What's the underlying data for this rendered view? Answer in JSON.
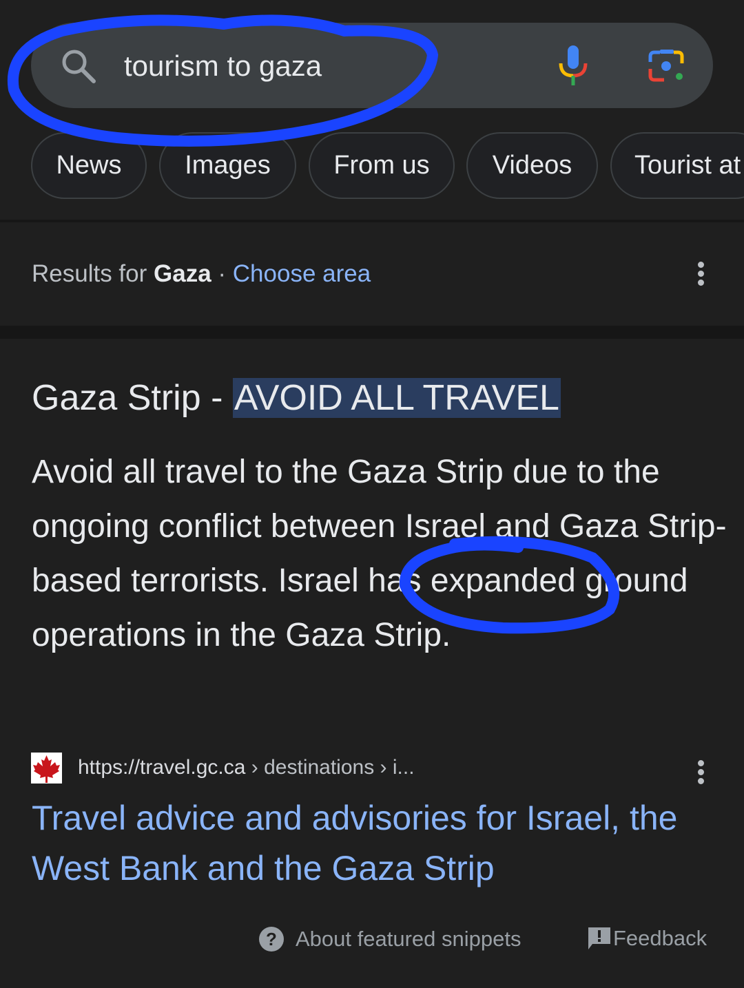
{
  "search": {
    "query": "tourism to gaza",
    "icons": [
      "search-icon",
      "microphone-icon",
      "google-lens-icon"
    ]
  },
  "chips": [
    {
      "label": "News"
    },
    {
      "label": "Images"
    },
    {
      "label": "From us"
    },
    {
      "label": "Videos"
    },
    {
      "label": "Tourist at"
    }
  ],
  "location": {
    "prefix": "Results for ",
    "place": "Gaza",
    "separator": " · ",
    "link": "Choose area"
  },
  "snippet": {
    "title_plain": "Gaza Strip - ",
    "title_highlight": "AVOID ALL TRAVEL",
    "text": "Avoid all travel to the Gaza Strip due to the ongoing conflict between Israel and Gaza Strip-based terrorists. Israel has expanded ground operations in the Gaza Strip.",
    "source_url": "https://travel.gc.ca",
    "source_path": " › destinations › i...",
    "link_title": "Travel advice and advisories for Israel, the West Bank and the Gaza Strip"
  },
  "footer": {
    "about": "About featured snippets",
    "feedback": "Feedback"
  },
  "colors": {
    "background": "#1f1f1f",
    "link": "#8ab4f8",
    "highlight": "#2a3d5f",
    "annotation": "#1a44ff"
  }
}
